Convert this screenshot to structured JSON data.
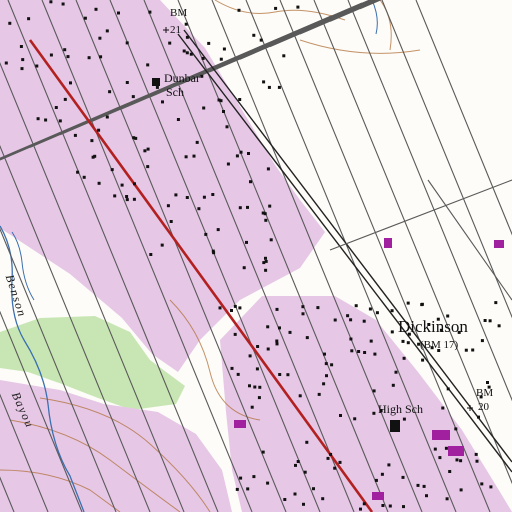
{
  "map": {
    "labels": {
      "place": "Dickinson",
      "place_bm": "(BM 17)",
      "bm_21_top": "BM",
      "bm_21_bottom": "21",
      "bm_20_top": "BM",
      "bm_20_bottom": "20",
      "school_north_top": "Dunbar",
      "school_north_bottom": "Sch",
      "school_south": "High Sch",
      "stream_1": "Benson",
      "stream_2": "Bayou"
    },
    "colors": {
      "background": "#fdfcf8",
      "urban_tint": "#e6c7e6",
      "street": "#5a5a5a",
      "railroad": "#222222",
      "highway": "#b32020",
      "stream": "#3a6fb0",
      "contour": "#b0703a",
      "vegetation": "#c8e6b4",
      "building": "#111111",
      "revision_purple": "#a020a0"
    }
  }
}
